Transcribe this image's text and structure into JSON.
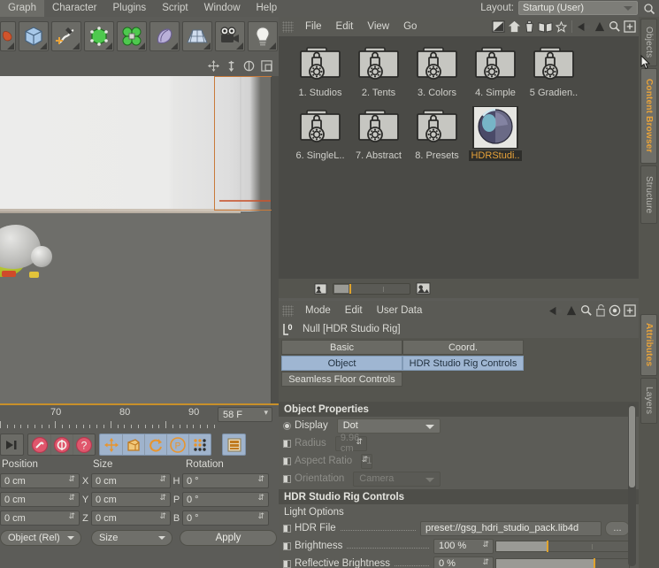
{
  "menubar": {
    "items": [
      "Graph",
      "Character",
      "Plugins",
      "Script",
      "Window",
      "Help"
    ],
    "layout_label": "Layout:",
    "layout_value": "Startup (User)",
    "search_icon": "search-icon"
  },
  "toolbar": {
    "icons": [
      "cube-icon",
      "spline-pen-icon",
      "green-cube-icon",
      "mograph-icon",
      "deformer-icon",
      "floor-grid-icon",
      "camera-icon",
      "light-bulb-icon"
    ]
  },
  "viewport": {
    "nav_icons": [
      "move-icon",
      "scale-icon",
      "rotate-icon",
      "maximize-icon"
    ]
  },
  "timeline": {
    "ticks": [
      "70",
      "80",
      "90"
    ],
    "frame_value": "58 F"
  },
  "bottom_toolbar": {
    "groups": [
      {
        "icons": [
          "goto-end-icon"
        ]
      },
      {
        "icons": [
          "record-key-icon",
          "autokey-icon",
          "keyframe-select-icon"
        ]
      },
      {
        "icons": [
          "move-tool-icon",
          "scale-tool-icon",
          "rotate-tool-icon",
          "parametric-icon",
          "points-icon"
        ],
        "highlight": true
      },
      {
        "icons": [
          "render-view-icon"
        ]
      }
    ]
  },
  "coordinates": {
    "headers": [
      "Position",
      "Size",
      "Rotation"
    ],
    "rows": [
      {
        "position": "0 cm",
        "axis": "X",
        "size": "0 cm",
        "rot_axis": "H",
        "rotation": "0 °"
      },
      {
        "position": "0 cm",
        "axis": "Y",
        "size": "0 cm",
        "rot_axis": "P",
        "rotation": "0 °"
      },
      {
        "position": "0 cm",
        "axis": "Z",
        "size": "0 cm",
        "rot_axis": "B",
        "rotation": "0 °"
      }
    ],
    "mode_select": "Object (Rel)",
    "size_select": "Size",
    "apply_label": "Apply"
  },
  "content_browser": {
    "menus": [
      "File",
      "Edit",
      "View",
      "Go"
    ],
    "toolbar_icons": [
      "preview-icon",
      "home-icon",
      "trash-icon",
      "library-icon",
      "favorites-icon",
      "back-arrow-icon",
      "up-arrow-icon",
      "search-icon",
      "new-tab-icon"
    ],
    "items": [
      {
        "label": "1. Studios",
        "type": "folder",
        "selected": false
      },
      {
        "label": "2. Tents",
        "type": "folder",
        "selected": false
      },
      {
        "label": "3. Colors",
        "type": "folder",
        "selected": false
      },
      {
        "label": "4. Simple",
        "type": "folder",
        "selected": false
      },
      {
        "label": "5 Gradien..",
        "type": "folder",
        "selected": false
      },
      {
        "label": "6. SingleL..",
        "type": "folder",
        "selected": false
      },
      {
        "label": "7. Abstract",
        "type": "folder",
        "selected": false
      },
      {
        "label": "8. Presets",
        "type": "folder",
        "selected": false
      },
      {
        "label": "HDRStudi..",
        "type": "preset",
        "selected": true
      }
    ],
    "footer": {
      "small_icon": "small-thumbnail-icon",
      "large_icon": "large-thumbnail-icon"
    }
  },
  "attributes": {
    "menus": [
      "Mode",
      "Edit",
      "User Data"
    ],
    "toolbar_icons": [
      "back-arrow-icon",
      "up-arrow-icon",
      "search-icon",
      "lock-icon",
      "target-icon",
      "new-tab-icon"
    ],
    "object_icon": "null-object-icon",
    "object_name": "Null [HDR Studio Rig]",
    "tabs": [
      {
        "label": "Basic",
        "active": false
      },
      {
        "label": "Coord.",
        "active": false
      },
      {
        "label": "Object",
        "active": true
      },
      {
        "label": "HDR Studio Rig Controls",
        "active": true
      },
      {
        "label": "Seamless Floor Controls",
        "active": false
      }
    ],
    "object_properties": {
      "title": "Object Properties",
      "rows": [
        {
          "label": "Display",
          "value": "Dot",
          "kind": "select",
          "disabled": false,
          "check": "radio"
        },
        {
          "label": "Radius",
          "value": "9.96 cm",
          "kind": "number",
          "disabled": true,
          "check": "half"
        },
        {
          "label": "Aspect Ratio",
          "value": "1",
          "kind": "number",
          "disabled": true,
          "check": "half"
        },
        {
          "label": "Orientation",
          "value": "Camera",
          "kind": "select",
          "disabled": true,
          "check": "half"
        }
      ]
    },
    "hdr_controls": {
      "title": "HDR Studio Rig Controls",
      "subtitle": "Light Options",
      "rows": [
        {
          "label": "HDR File",
          "value": "preset://gsg_hdri_studio_pack.lib4d",
          "kind": "file",
          "button": "...",
          "check": "half"
        },
        {
          "label": "Brightness",
          "value": "100 %",
          "kind": "slider",
          "fill_pct": 38,
          "mark_pct": 38,
          "tick_pct": 72,
          "check": "half"
        },
        {
          "label": "Reflective Brightness",
          "value": "0 %",
          "kind": "slider",
          "fill_pct": 73,
          "mark_pct": 73,
          "tick_pct": 0,
          "check": "half"
        }
      ]
    }
  },
  "right_tabs": [
    {
      "label": "Objects",
      "active": false
    },
    {
      "label": "Content Browser",
      "active": true
    },
    {
      "label": "Structure",
      "active": false
    },
    {
      "label": "Attributes",
      "active": true
    },
    {
      "label": "Layers",
      "active": false
    }
  ],
  "colors": {
    "accent_orange": "#e8a33a",
    "tab_blue": "#9fb6d2",
    "panel_bg": "#55554f",
    "app_bg": "#5c5c58",
    "slider_orange": "#e0a32c"
  }
}
